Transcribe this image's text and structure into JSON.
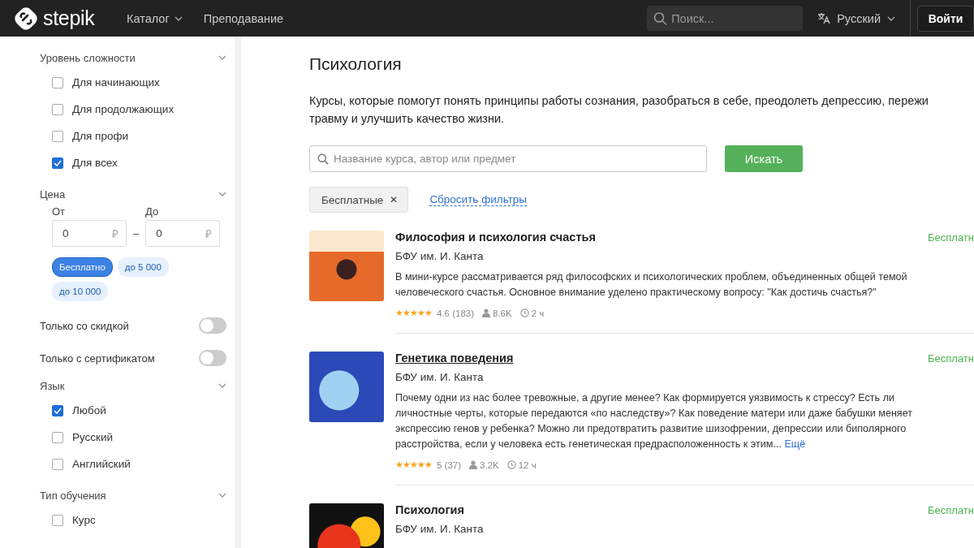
{
  "header": {
    "logo": "stepik",
    "nav": [
      {
        "label": "Каталог",
        "dropdown": true
      },
      {
        "label": "Преподавание",
        "dropdown": false
      }
    ],
    "search": {
      "placeholder": "Поиск..."
    },
    "language": "Русский",
    "login": "Войти"
  },
  "sidebar": {
    "sections": [
      {
        "kind": "checklist",
        "title": "Уровень сложности",
        "items": [
          {
            "label": "Для начинающих",
            "checked": false
          },
          {
            "label": "Для продолжающих",
            "checked": false
          },
          {
            "label": "Для профи",
            "checked": false
          },
          {
            "label": "Для всех",
            "checked": true
          }
        ]
      },
      {
        "kind": "price",
        "title": "Цена",
        "from": {
          "label": "От",
          "value": "0",
          "currency": "₽"
        },
        "to": {
          "label": "До",
          "value": "0",
          "currency": "₽"
        },
        "separator": "–",
        "chips": [
          {
            "label": "Бесплатно",
            "selected": true
          },
          {
            "label": "до 5 000",
            "selected": false
          },
          {
            "label": "до 10 000",
            "selected": false
          }
        ]
      },
      {
        "kind": "toggle",
        "title": "Только со скидкой",
        "on": false
      },
      {
        "kind": "toggle",
        "title": "Только с сертификатом",
        "on": false
      },
      {
        "kind": "checklist",
        "title": "Язык",
        "items": [
          {
            "label": "Любой",
            "checked": true
          },
          {
            "label": "Русский",
            "checked": false
          },
          {
            "label": "Английский",
            "checked": false
          }
        ]
      },
      {
        "kind": "checklist",
        "title": "Тип обучения",
        "items": [
          {
            "label": "Курс",
            "checked": false
          }
        ]
      }
    ]
  },
  "main": {
    "title": "Психология",
    "description": [
      "Курсы, которые помогут понять принципы работы сознания, разобраться в себе, преодолеть депрессию, пережи",
      "травму и улучшить качество жизни."
    ],
    "search": {
      "placeholder": "Название курса, автор или предмет",
      "button": "Искать"
    },
    "active_filters": [
      {
        "label": "Бесплатные",
        "remove": "✕"
      }
    ],
    "reset": "Сбросить фильтры",
    "courses": [
      {
        "title": "Философия и психология счастья",
        "underlined": false,
        "author": "БФУ им. И. Канта",
        "price": "Бесплатн",
        "description": "В мини-курсе рассматривается ряд философских и психологических проблем, объединенных общей темой человеческого счастья. Основное внимание уделено практическому вопросу: \"Как достичь счастья?\"",
        "stars": 5,
        "rating": "4.6 (183)",
        "learners": "8.6K",
        "duration": "2 ч"
      },
      {
        "title": "Генетика поведения",
        "underlined": true,
        "author": "БФУ им. И. Канта",
        "price": "Бесплатн",
        "description": "Почему одни из нас более тревожные, а другие менее? Как формируется уязвимость к стрессу? Есть ли личностные черты, которые передаются «по наследству»? Как поведение матери или даже бабушки меняет экспрессию генов у ребенка? Можно ли предотвратить развитие шизофрении, депрессии или биполярного расстройства, если у человека есть генетическая предрасположенность к этим...",
        "more": "Ещё",
        "stars": 5,
        "rating": "5 (37)",
        "learners": "3.2K",
        "duration": "12 ч"
      },
      {
        "title": "Психология",
        "underlined": false,
        "author": "БФУ им. И. Канта",
        "price": "Бесплатн"
      }
    ]
  }
}
